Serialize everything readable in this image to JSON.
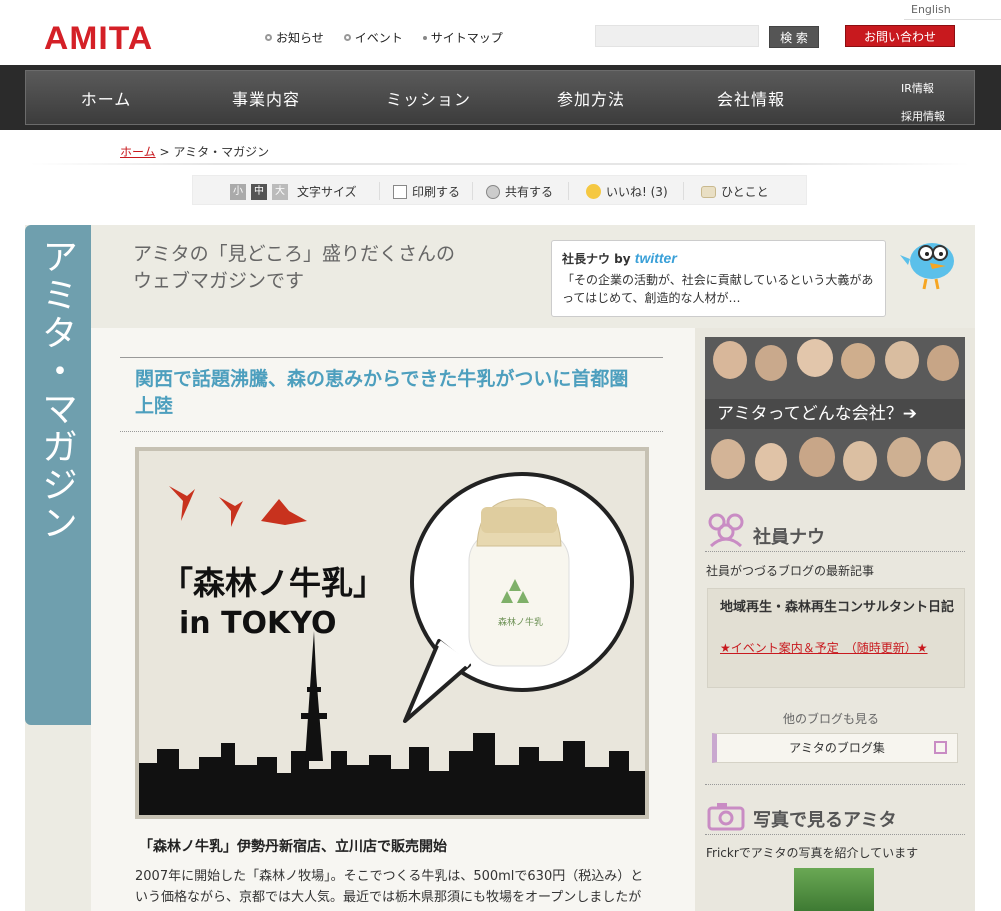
{
  "header": {
    "logo": "AMITA",
    "topnav": [
      "お知らせ",
      "イベント",
      "サイトマップ"
    ],
    "search_button": "検 索",
    "contact_button": "お問い合わせ",
    "english_link": "English"
  },
  "mainnav": {
    "items": [
      "ホーム",
      "事業内容",
      "ミッション",
      "参加方法",
      "会社情報"
    ],
    "small_items": [
      "IR情報",
      "採用情報"
    ]
  },
  "breadcrumb": {
    "home": "ホーム",
    "sep": " > ",
    "current": "アミタ・マガジン"
  },
  "toolbar": {
    "size_small": "小",
    "size_mid": "中",
    "size_big": "大",
    "font_size_label": "文字サイズ",
    "print_label": "印刷する",
    "share_label": "共有する",
    "like_label": "いいね! (3)",
    "comment_label": "ひとこと"
  },
  "magazine": {
    "side_title": "アミタ・マガジン",
    "intro_line1": "アミタの「見どころ」盛りだくさんの",
    "intro_line2": "ウェブマガジンです"
  },
  "twitter_box": {
    "head": "社長ナウ by",
    "brand": "twitter",
    "text": "「その企業の活動が、社会に貢献しているという大義があってはじめて、創造的な人材が…"
  },
  "article": {
    "title": "関西で話題沸騰、森の恵みからできた牛乳がついに首都圏上陸",
    "hero_heading_1": "「森林ノ牛乳」",
    "hero_heading_2": "in TOKYO",
    "bottle_label": "森林ノ牛乳",
    "caption": "「森林ノ牛乳」伊勢丹新宿店、立川店で販売開始",
    "body": "2007年に開始した「森林ノ牧場」。そこでつくる牛乳は、500mlで630円（税込み）という価格ながら、京都では大人気。最近では栃木県那須にも牧場をオープンしましたが"
  },
  "sidebar": {
    "promo_label": "アミタってどんな会社？➔",
    "staff_title": "社員ナウ",
    "staff_sub": "社員がつづるブログの最新記事",
    "blog_title": "地域再生・森林再生コンサルタント日記",
    "blog_link": "★イベント案内＆予定　（随時更新）★",
    "more_label": "他のブログも見る",
    "blog_button": "アミタのブログ集",
    "photo_title": "写真で見るアミタ",
    "photo_sub": "Frickrでアミタの写真を紹介しています"
  },
  "colors": {
    "brand_red": "#d42027",
    "accent_blue": "#4d9fbe",
    "side_tab": "#6f9fae"
  }
}
